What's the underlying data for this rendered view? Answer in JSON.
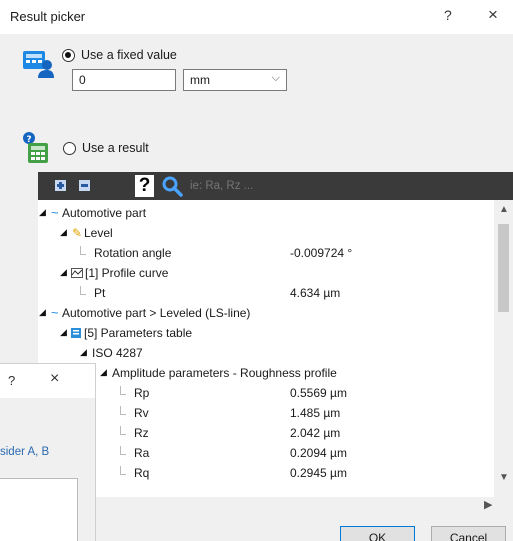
{
  "window": {
    "title": "Result picker",
    "help_label": "?",
    "close_label": "×"
  },
  "fixed_value": {
    "label": "Use a fixed value",
    "value": "0",
    "unit": "mm",
    "selected": true
  },
  "result_option": {
    "label": "Use a result",
    "selected": false
  },
  "toolbar": {
    "help_label": "?",
    "filter_placeholder": "ie: Ra, Rz ..."
  },
  "tree": {
    "node_automotive": "Automotive part",
    "node_level": "Level",
    "rotation_label": "Rotation angle",
    "rotation_value": "-0.009724 °",
    "node_profile": "[1] Profile curve",
    "pt_label": "Pt",
    "pt_value": "4.634 µm",
    "node_leveled": "Automotive part > Leveled (LS-line)",
    "node_params": "[5] Parameters table",
    "node_iso": "ISO 4287",
    "node_amplitude": "Amplitude parameters - Roughness profile",
    "params": [
      {
        "name": "Rp",
        "value": "0.5569 µm"
      },
      {
        "name": "Rv",
        "value": "1.485 µm"
      },
      {
        "name": "Rz",
        "value": "2.042 µm"
      },
      {
        "name": "Ra",
        "value": "0.2094 µm"
      },
      {
        "name": "Rq",
        "value": "0.2945 µm"
      }
    ]
  },
  "buttons": {
    "ok": "OK",
    "cancel": "Cancel"
  },
  "overlay": {
    "help_label": "?",
    "close_label": "×",
    "text": "sider A, B"
  },
  "colors": {
    "toolbar_bg": "#3a3a3a",
    "accent_blue": "#1e88e5",
    "link_blue": "#2a6ab0"
  }
}
